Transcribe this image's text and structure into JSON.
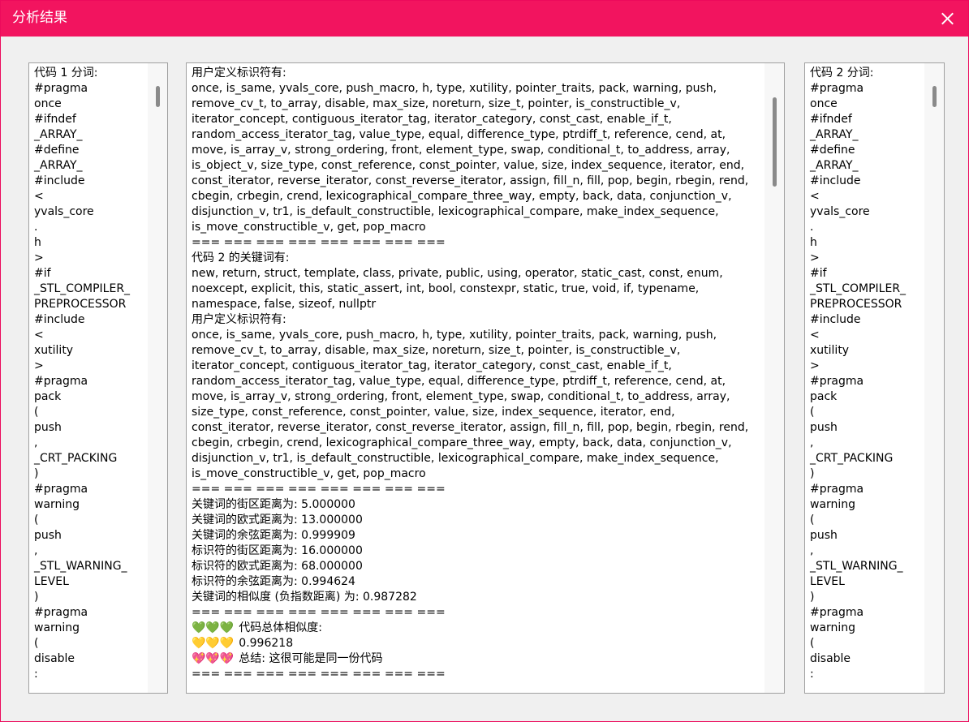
{
  "window": {
    "title": "分析结果",
    "close_icon": "close-icon",
    "accent_color": "#f2145f"
  },
  "left_panel": {
    "lines": [
      "代码 1 分词:",
      "#pragma",
      "once",
      "#ifndef",
      "_ARRAY_",
      "#define",
      "_ARRAY_",
      "#include",
      "<",
      "yvals_core",
      ".",
      "h",
      ">",
      "#if",
      "_STL_COMPILER_",
      "PREPROCESSOR",
      "#include",
      "<",
      "xutility",
      ">",
      "#pragma",
      "pack",
      "(",
      "push",
      ",",
      "_CRT_PACKING",
      ")",
      "#pragma",
      "warning",
      "(",
      "push",
      ",",
      "_STL_WARNING_",
      "LEVEL",
      ")",
      "#pragma",
      "warning",
      "(",
      "disable",
      ":"
    ]
  },
  "center_panel": {
    "lines": [
      "用户定义标识符有:",
      "once, is_same, yvals_core, push_macro, h, type, xutility, pointer_traits, pack, warning, push,",
      "remove_cv_t, to_array, disable, max_size, noreturn, size_t, pointer, is_constructible_v,",
      "iterator_concept, contiguous_iterator_tag, iterator_category, const_cast, enable_if_t,",
      "random_access_iterator_tag, value_type, equal, difference_type, ptrdiff_t, reference, cend, at,",
      "move, is_array_v, strong_ordering, front, element_type, swap, conditional_t, to_address, array,",
      "is_object_v, size_type, const_reference, const_pointer, value, size, index_sequence, iterator, end,",
      "const_iterator, reverse_iterator, const_reverse_iterator, assign, fill_n, fill, pop, begin, rbegin, rend,",
      "cbegin, crbegin, crend, lexicographical_compare_three_way, empty, back, data, conjunction_v,",
      "disjunction_v, tr1, is_default_constructible, lexicographical_compare, make_index_sequence,",
      "is_move_constructible_v, get, pop_macro",
      "=== === === === === === === ===",
      "代码 2 的关键词有:",
      "new, return, struct, template, class, private, public, using, operator, static_cast, const, enum,",
      "noexcept, explicit, this, static_assert, int, bool, constexpr, static, true, void, if, typename,",
      "namespace, false, sizeof, nullptr",
      "用户定义标识符有:",
      "once, is_same, yvals_core, push_macro, h, type, xutility, pointer_traits, pack, warning, push,",
      "remove_cv_t, to_array, disable, max_size, noreturn, size_t, pointer, is_constructible_v,",
      "iterator_concept, contiguous_iterator_tag, iterator_category, const_cast, enable_if_t,",
      "random_access_iterator_tag, value_type, equal, difference_type, ptrdiff_t, reference, cend, at,",
      "move, is_array_v, strong_ordering, front, element_type, swap, conditional_t, to_address, array,",
      "size_type, const_reference, const_pointer, value, size, index_sequence, iterator, end,",
      "const_iterator, reverse_iterator, const_reverse_iterator, assign, fill_n, fill, pop, begin, rbegin, rend,",
      "cbegin, crbegin, crend, lexicographical_compare_three_way, empty, back, data, conjunction_v,",
      "disjunction_v, tr1, is_default_constructible, lexicographical_compare, make_index_sequence,",
      "is_move_constructible_v, get, pop_macro",
      "=== === === === === === === ===",
      "关键词的街区距离为: 5.000000",
      "关键词的欧式距离为: 13.000000",
      "关键词的余弦距离为: 0.999909",
      "标识符的街区距离为: 16.000000",
      "标识符的欧式距离为: 68.000000",
      "标识符的余弦距离为: 0.994624",
      "关键词的相似度 (负指数距离) 为: 0.987282",
      "=== === === === === === === ==="
    ],
    "similarity_label": "代码总体相似度:",
    "similarity_value": "0.996218",
    "summary": "总结: 这很可能是同一份代码",
    "final_separator": "=== === === === === === === ===",
    "green_hearts": "💚💚💚",
    "yellow_hearts": "💛💛💛",
    "pink_hearts": "💖💖💖"
  },
  "right_panel": {
    "lines": [
      "代码 2 分词:",
      "#pragma",
      "once",
      "#ifndef",
      "_ARRAY_",
      "#define",
      "_ARRAY_",
      "#include",
      "<",
      "yvals_core",
      ".",
      "h",
      ">",
      "#if",
      "_STL_COMPILER_",
      "PREPROCESSOR",
      "#include",
      "<",
      "xutility",
      ">",
      "#pragma",
      "pack",
      "(",
      "push",
      ",",
      "_CRT_PACKING",
      ")",
      "#pragma",
      "warning",
      "(",
      "push",
      ",",
      "_STL_WARNING_",
      "LEVEL",
      ")",
      "#pragma",
      "warning",
      "(",
      "disable",
      ":"
    ]
  }
}
